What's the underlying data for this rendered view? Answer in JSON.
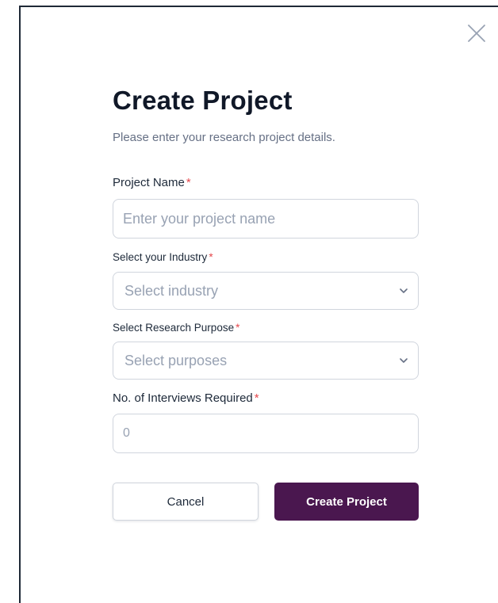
{
  "dialog": {
    "title": "Create Project",
    "subtitle": "Please enter your research project details.",
    "close_icon": "close-icon"
  },
  "form": {
    "project_name": {
      "label": "Project Name",
      "required_mark": "*",
      "placeholder": "Enter your project name"
    },
    "industry": {
      "label": "Select your Industry",
      "required_mark": "*",
      "selected": "Select industry",
      "icon": "chevron-down-icon"
    },
    "purpose": {
      "label": "Select Research Purpose",
      "required_mark": "*",
      "selected": "Select purposes",
      "icon": "chevron-down-icon"
    },
    "interviews": {
      "label": "No. of Interviews Required",
      "required_mark": "*",
      "placeholder": "0"
    }
  },
  "actions": {
    "cancel_label": "Cancel",
    "create_label": "Create Project"
  },
  "colors": {
    "primary_button": "#4a174f",
    "required_asterisk": "#e5484d",
    "title_text": "#101828",
    "muted_text": "#667085",
    "border": "#d0d5dd"
  }
}
